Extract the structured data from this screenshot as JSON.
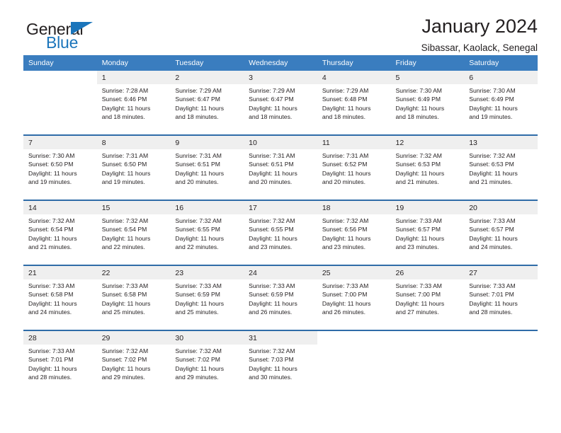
{
  "brand": {
    "name_dark": "General",
    "name_light": "Blue",
    "accent_color": "#1b75bb"
  },
  "header": {
    "title": "January 2024",
    "subtitle": "Sibassar, Kaolack, Senegal"
  },
  "calendar": {
    "header_bg": "#3a7dbf",
    "daynum_bg": "#efefef",
    "weekday_names": [
      "Sunday",
      "Monday",
      "Tuesday",
      "Wednesday",
      "Thursday",
      "Friday",
      "Saturday"
    ],
    "weeks": [
      [
        {
          "day": "",
          "lines": []
        },
        {
          "day": "1",
          "lines": [
            "Sunrise: 7:28 AM",
            "Sunset: 6:46 PM",
            "Daylight: 11 hours",
            "and 18 minutes."
          ]
        },
        {
          "day": "2",
          "lines": [
            "Sunrise: 7:29 AM",
            "Sunset: 6:47 PM",
            "Daylight: 11 hours",
            "and 18 minutes."
          ]
        },
        {
          "day": "3",
          "lines": [
            "Sunrise: 7:29 AM",
            "Sunset: 6:47 PM",
            "Daylight: 11 hours",
            "and 18 minutes."
          ]
        },
        {
          "day": "4",
          "lines": [
            "Sunrise: 7:29 AM",
            "Sunset: 6:48 PM",
            "Daylight: 11 hours",
            "and 18 minutes."
          ]
        },
        {
          "day": "5",
          "lines": [
            "Sunrise: 7:30 AM",
            "Sunset: 6:49 PM",
            "Daylight: 11 hours",
            "and 18 minutes."
          ]
        },
        {
          "day": "6",
          "lines": [
            "Sunrise: 7:30 AM",
            "Sunset: 6:49 PM",
            "Daylight: 11 hours",
            "and 19 minutes."
          ]
        }
      ],
      [
        {
          "day": "7",
          "lines": [
            "Sunrise: 7:30 AM",
            "Sunset: 6:50 PM",
            "Daylight: 11 hours",
            "and 19 minutes."
          ]
        },
        {
          "day": "8",
          "lines": [
            "Sunrise: 7:31 AM",
            "Sunset: 6:50 PM",
            "Daylight: 11 hours",
            "and 19 minutes."
          ]
        },
        {
          "day": "9",
          "lines": [
            "Sunrise: 7:31 AM",
            "Sunset: 6:51 PM",
            "Daylight: 11 hours",
            "and 20 minutes."
          ]
        },
        {
          "day": "10",
          "lines": [
            "Sunrise: 7:31 AM",
            "Sunset: 6:51 PM",
            "Daylight: 11 hours",
            "and 20 minutes."
          ]
        },
        {
          "day": "11",
          "lines": [
            "Sunrise: 7:31 AM",
            "Sunset: 6:52 PM",
            "Daylight: 11 hours",
            "and 20 minutes."
          ]
        },
        {
          "day": "12",
          "lines": [
            "Sunrise: 7:32 AM",
            "Sunset: 6:53 PM",
            "Daylight: 11 hours",
            "and 21 minutes."
          ]
        },
        {
          "day": "13",
          "lines": [
            "Sunrise: 7:32 AM",
            "Sunset: 6:53 PM",
            "Daylight: 11 hours",
            "and 21 minutes."
          ]
        }
      ],
      [
        {
          "day": "14",
          "lines": [
            "Sunrise: 7:32 AM",
            "Sunset: 6:54 PM",
            "Daylight: 11 hours",
            "and 21 minutes."
          ]
        },
        {
          "day": "15",
          "lines": [
            "Sunrise: 7:32 AM",
            "Sunset: 6:54 PM",
            "Daylight: 11 hours",
            "and 22 minutes."
          ]
        },
        {
          "day": "16",
          "lines": [
            "Sunrise: 7:32 AM",
            "Sunset: 6:55 PM",
            "Daylight: 11 hours",
            "and 22 minutes."
          ]
        },
        {
          "day": "17",
          "lines": [
            "Sunrise: 7:32 AM",
            "Sunset: 6:55 PM",
            "Daylight: 11 hours",
            "and 23 minutes."
          ]
        },
        {
          "day": "18",
          "lines": [
            "Sunrise: 7:32 AM",
            "Sunset: 6:56 PM",
            "Daylight: 11 hours",
            "and 23 minutes."
          ]
        },
        {
          "day": "19",
          "lines": [
            "Sunrise: 7:33 AM",
            "Sunset: 6:57 PM",
            "Daylight: 11 hours",
            "and 23 minutes."
          ]
        },
        {
          "day": "20",
          "lines": [
            "Sunrise: 7:33 AM",
            "Sunset: 6:57 PM",
            "Daylight: 11 hours",
            "and 24 minutes."
          ]
        }
      ],
      [
        {
          "day": "21",
          "lines": [
            "Sunrise: 7:33 AM",
            "Sunset: 6:58 PM",
            "Daylight: 11 hours",
            "and 24 minutes."
          ]
        },
        {
          "day": "22",
          "lines": [
            "Sunrise: 7:33 AM",
            "Sunset: 6:58 PM",
            "Daylight: 11 hours",
            "and 25 minutes."
          ]
        },
        {
          "day": "23",
          "lines": [
            "Sunrise: 7:33 AM",
            "Sunset: 6:59 PM",
            "Daylight: 11 hours",
            "and 25 minutes."
          ]
        },
        {
          "day": "24",
          "lines": [
            "Sunrise: 7:33 AM",
            "Sunset: 6:59 PM",
            "Daylight: 11 hours",
            "and 26 minutes."
          ]
        },
        {
          "day": "25",
          "lines": [
            "Sunrise: 7:33 AM",
            "Sunset: 7:00 PM",
            "Daylight: 11 hours",
            "and 26 minutes."
          ]
        },
        {
          "day": "26",
          "lines": [
            "Sunrise: 7:33 AM",
            "Sunset: 7:00 PM",
            "Daylight: 11 hours",
            "and 27 minutes."
          ]
        },
        {
          "day": "27",
          "lines": [
            "Sunrise: 7:33 AM",
            "Sunset: 7:01 PM",
            "Daylight: 11 hours",
            "and 28 minutes."
          ]
        }
      ],
      [
        {
          "day": "28",
          "lines": [
            "Sunrise: 7:33 AM",
            "Sunset: 7:01 PM",
            "Daylight: 11 hours",
            "and 28 minutes."
          ]
        },
        {
          "day": "29",
          "lines": [
            "Sunrise: 7:32 AM",
            "Sunset: 7:02 PM",
            "Daylight: 11 hours",
            "and 29 minutes."
          ]
        },
        {
          "day": "30",
          "lines": [
            "Sunrise: 7:32 AM",
            "Sunset: 7:02 PM",
            "Daylight: 11 hours",
            "and 29 minutes."
          ]
        },
        {
          "day": "31",
          "lines": [
            "Sunrise: 7:32 AM",
            "Sunset: 7:03 PM",
            "Daylight: 11 hours",
            "and 30 minutes."
          ]
        },
        {
          "day": "",
          "lines": []
        },
        {
          "day": "",
          "lines": []
        },
        {
          "day": "",
          "lines": []
        }
      ]
    ]
  }
}
